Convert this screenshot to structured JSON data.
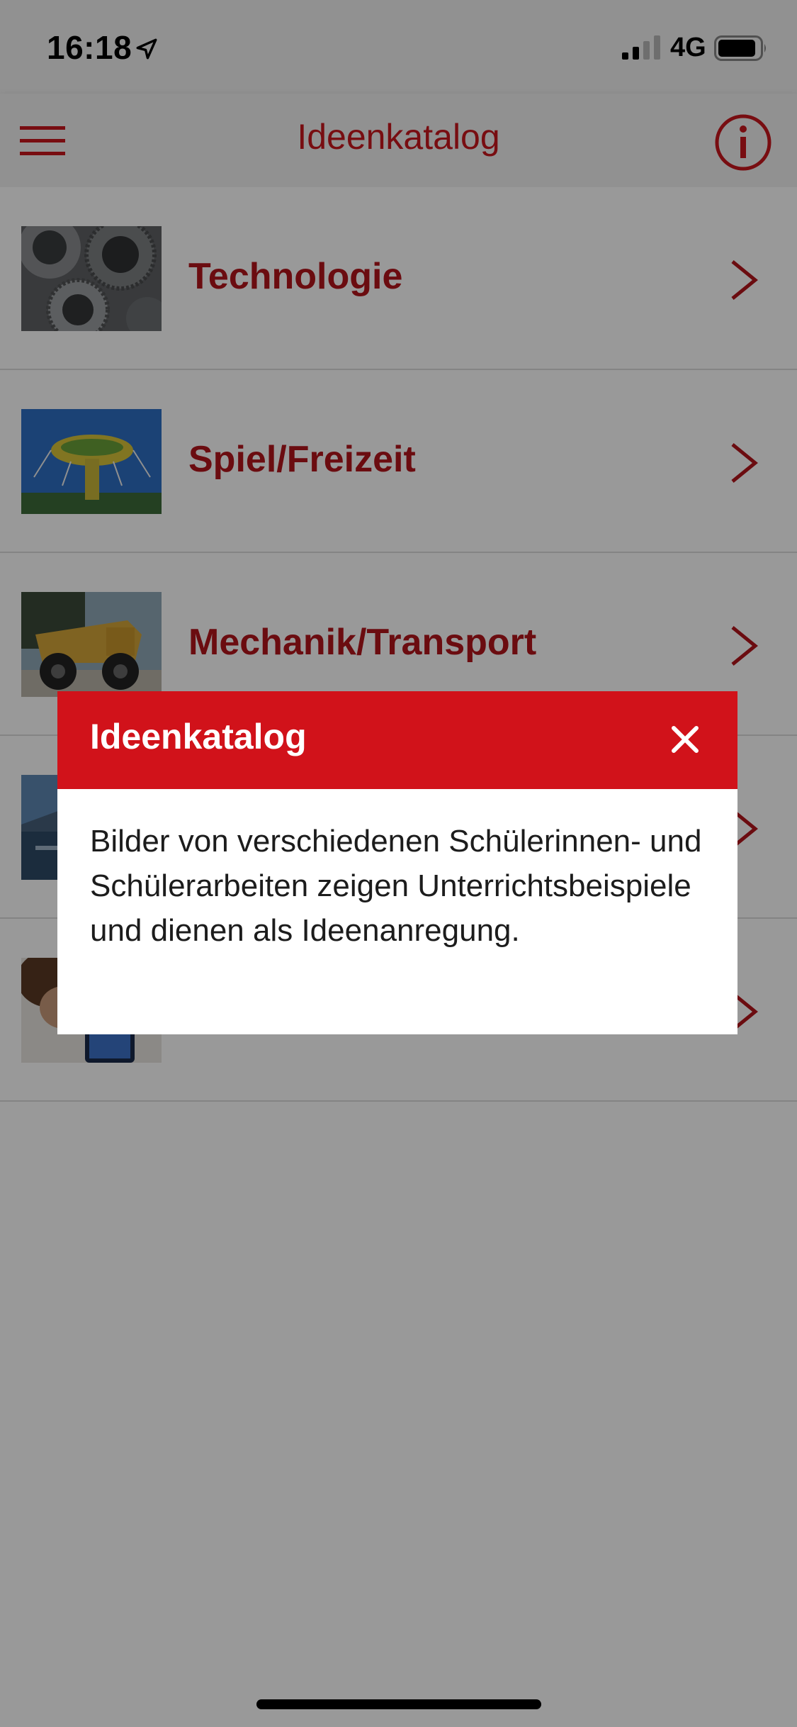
{
  "status_bar": {
    "time": "16:18",
    "network": "4G",
    "icons": [
      "location-arrow-icon",
      "cellular-signal-icon",
      "battery-icon"
    ]
  },
  "nav": {
    "title": "Ideenkatalog",
    "menu_icon": "hamburger-menu-icon",
    "info_icon": "info-icon"
  },
  "list": {
    "items": [
      {
        "label": "Technologie",
        "thumb": "gears-photo"
      },
      {
        "label": "Spiel/Freizeit",
        "thumb": "swing-carousel-photo"
      },
      {
        "label": "Mechanik/Transport",
        "thumb": "dump-truck-photo"
      },
      {
        "label": "",
        "thumb": "landscape-photo"
      },
      {
        "label": "",
        "thumb": "tablet-student-photo"
      }
    ]
  },
  "dialog": {
    "title": "Ideenkatalog",
    "close_icon": "close-icon",
    "body": "Bilder von verschiedenen Schülerinnen- und Schülerarbeiten zeigen Unterrichtsbeispiele und dienen als Ideenanregung."
  },
  "colors": {
    "accent": "#c8161d",
    "dialog_header": "#d1121a",
    "overlay": "rgba(0,0,0,0.40)"
  }
}
